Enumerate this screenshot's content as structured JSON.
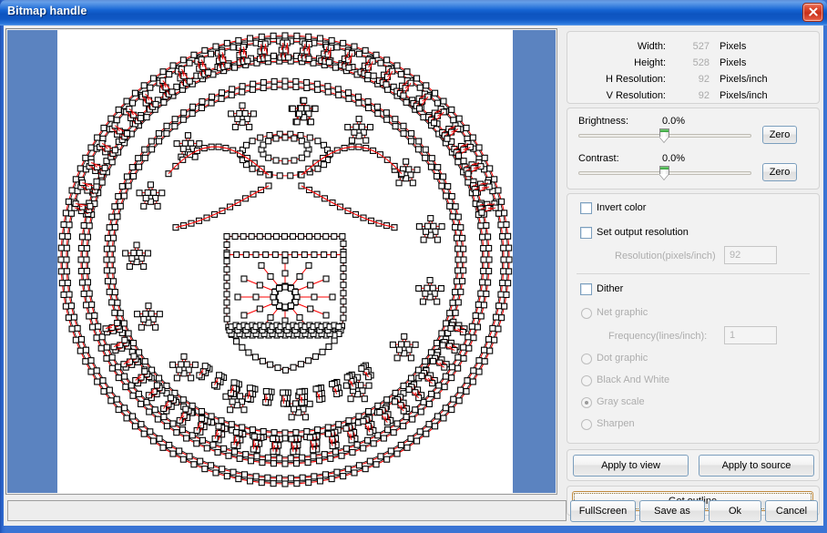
{
  "window": {
    "title": "Bitmap handle",
    "close_icon": "close-icon"
  },
  "preview": {
    "artwork_label": "Department of the Air Force seal vector outline",
    "background_color": "#5b83c0",
    "canvas_color": "#ffffff",
    "path_color": "#ff0000",
    "node_color": "#000000"
  },
  "info": {
    "rows": [
      {
        "name": "Width:",
        "value": "527",
        "unit": "Pixels"
      },
      {
        "name": "Height:",
        "value": "528",
        "unit": "Pixels"
      },
      {
        "name": "H Resolution:",
        "value": "92",
        "unit": "Pixels/inch"
      },
      {
        "name": "V Resolution:",
        "value": "92",
        "unit": "Pixels/inch"
      }
    ]
  },
  "adjust": {
    "brightness_label": "Brightness:",
    "brightness_value": "0.0%",
    "brightness_zero": "Zero",
    "contrast_label": "Contrast:",
    "contrast_value": "0.0%",
    "contrast_zero": "Zero"
  },
  "options": {
    "invert_color": "Invert color",
    "set_output_resolution": "Set output resolution",
    "resolution_label": "Resolution(pixels/inch)",
    "resolution_value": "92",
    "dither": "Dither",
    "net_graphic": "Net graphic",
    "frequency_label": "Frequency(lines/inch):",
    "frequency_value": "1",
    "dot_graphic": "Dot graphic",
    "black_and_white": "Black And White",
    "gray_scale": "Gray scale",
    "sharpen": "Sharpen"
  },
  "apply": {
    "apply_to_view": "Apply to view",
    "apply_to_source": "Apply to source"
  },
  "outline": {
    "get_outline": "Get outline"
  },
  "bottom": {
    "fullscreen": "FullScreen",
    "save_as": "Save as",
    "ok": "Ok",
    "cancel": "Cancel",
    "progress_text": ""
  }
}
